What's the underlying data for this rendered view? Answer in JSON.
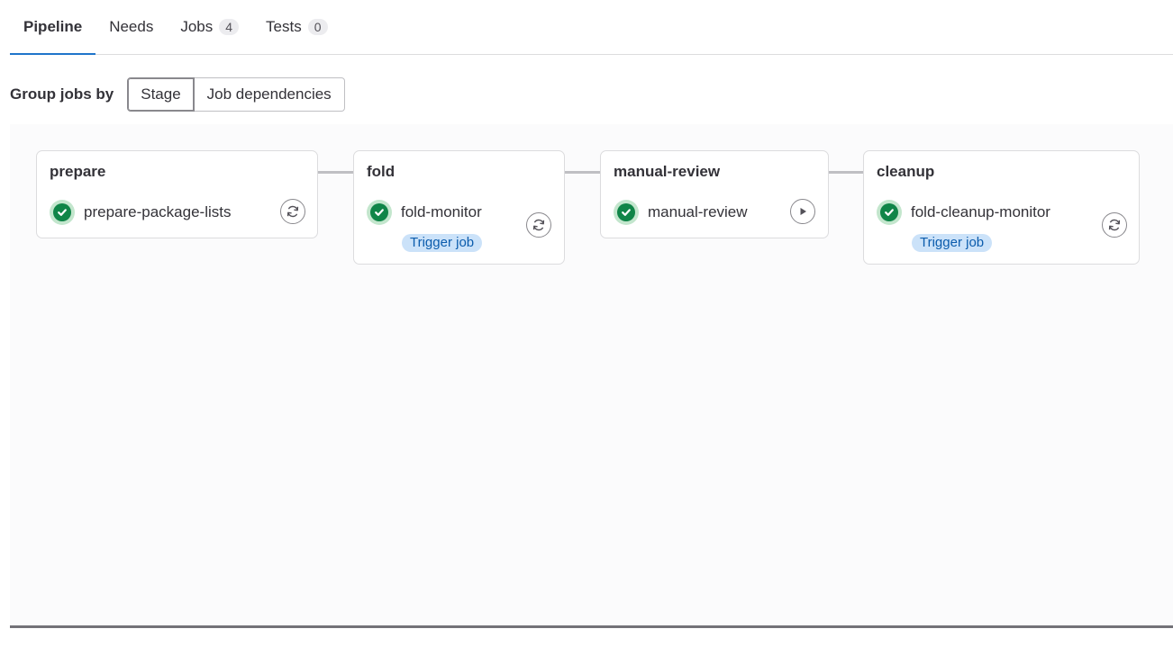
{
  "tabs": [
    {
      "label": "Pipeline",
      "count": null,
      "active": true
    },
    {
      "label": "Needs",
      "count": null,
      "active": false
    },
    {
      "label": "Jobs",
      "count": "4",
      "active": false
    },
    {
      "label": "Tests",
      "count": "0",
      "active": false
    }
  ],
  "group_by": {
    "label": "Group jobs by",
    "options": [
      "Stage",
      "Job dependencies"
    ],
    "selected": "Stage"
  },
  "stages": [
    {
      "name": "prepare",
      "jobs": [
        {
          "name": "prepare-package-lists",
          "status": "success",
          "action": "retry-icon"
        }
      ]
    },
    {
      "name": "fold",
      "jobs": [
        {
          "name": "fold-monitor",
          "status": "success",
          "badge": "Trigger job",
          "action": "retry-icon"
        }
      ]
    },
    {
      "name": "manual-review",
      "jobs": [
        {
          "name": "manual-review",
          "status": "success",
          "action": "play-icon"
        }
      ]
    },
    {
      "name": "cleanup",
      "jobs": [
        {
          "name": "fold-cleanup-monitor",
          "status": "success",
          "badge": "Trigger job",
          "action": "retry-icon"
        }
      ]
    }
  ],
  "colors": {
    "success": "#108548",
    "accent": "#1f75cb",
    "badge_bg": "#cbe2f9",
    "badge_text": "#0b5cad"
  }
}
